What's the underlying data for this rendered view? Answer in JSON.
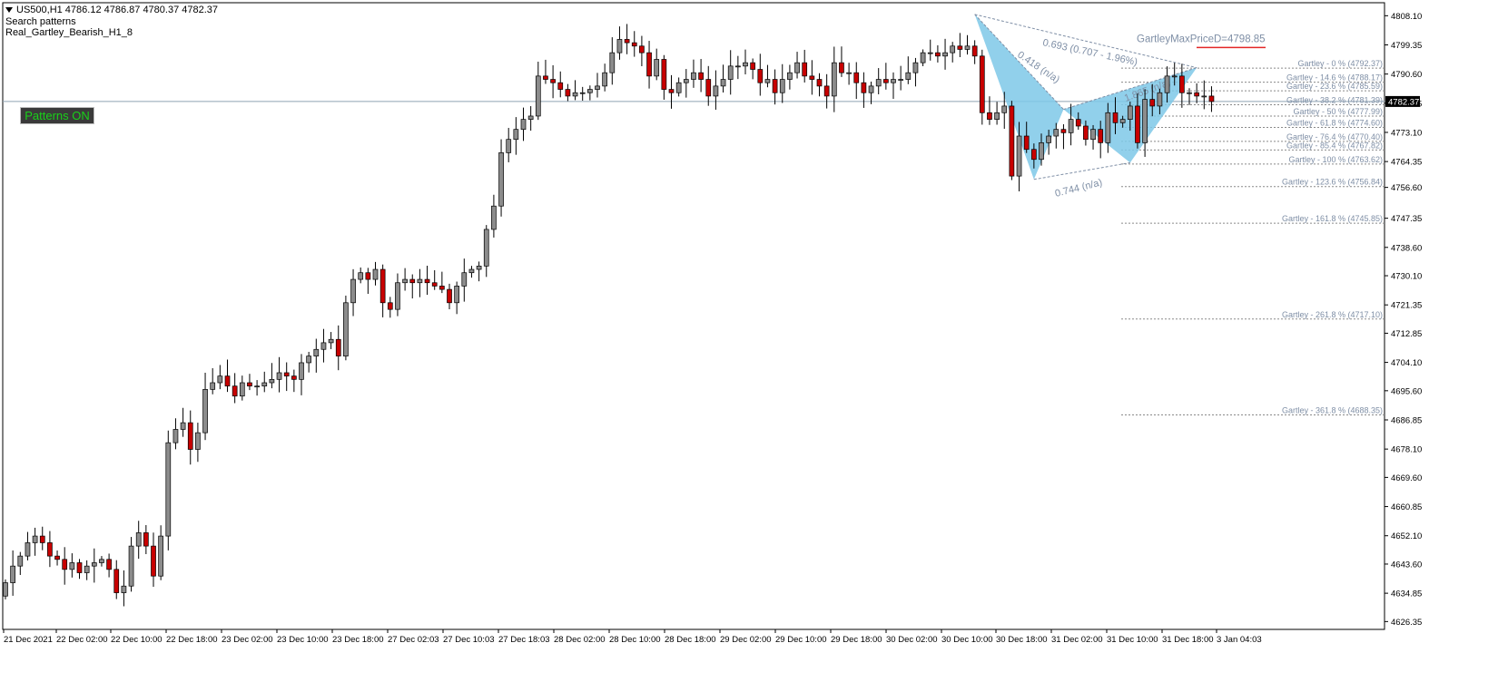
{
  "header": {
    "symbol_line": "US500,H1  4786.12 4786.87 4780.37 4782.37",
    "indicator_line": "Search patterns",
    "pattern_name": "Real_Gartley_Bearish_H1_8"
  },
  "button": {
    "label": "Patterns ON"
  },
  "colors": {
    "bull": "#8c8c8c",
    "bear": "#c80000",
    "wick": "#000000",
    "pattern_fill": "#7ec8e8",
    "fib_text": "#7f8fa6",
    "maxprice_line": "#e32626",
    "price_tag_bg": "#000000"
  },
  "chart_data": {
    "type": "candlestick",
    "symbol": "US500",
    "timeframe": "H1",
    "ylim": [
      4624,
      4812
    ],
    "yticks": [
      "4808.10",
      "4799.35",
      "4790.60",
      "4781.85",
      "4773.10",
      "4764.35",
      "4756.60",
      "4747.35",
      "4738.60",
      "4730.10",
      "4721.35",
      "4712.85",
      "4704.10",
      "4695.60",
      "4686.85",
      "4678.10",
      "4669.60",
      "4660.85",
      "4652.10",
      "4643.60",
      "4634.85",
      "4626.35"
    ],
    "xticks": [
      "21 Dec 2021",
      "22 Dec 02:00",
      "22 Dec 10:00",
      "22 Dec 18:00",
      "23 Dec 02:00",
      "23 Dec 10:00",
      "23 Dec 18:00",
      "27 Dec 02:03",
      "27 Dec 10:03",
      "27 Dec 18:03",
      "28 Dec 02:00",
      "28 Dec 10:00",
      "28 Dec 18:00",
      "29 Dec 02:00",
      "29 Dec 10:00",
      "29 Dec 18:00",
      "30 Dec 02:00",
      "30 Dec 10:00",
      "30 Dec 18:00",
      "31 Dec 02:00",
      "31 Dec 10:00",
      "31 Dec 18:00",
      "3 Jan 04:03"
    ],
    "current_price": 4782.37,
    "current_price_label": "4782.37",
    "closes": [
      4638,
      4643,
      4646,
      4650,
      4652,
      4650,
      4646,
      4645,
      4642,
      4644,
      4641,
      4643,
      4644,
      4645,
      4642,
      4635,
      4637,
      4649,
      4653,
      4649,
      4640,
      4652,
      4680,
      4684,
      4686,
      4678,
      4683,
      4696,
      4698,
      4700,
      4697,
      4694,
      4698,
      4697,
      4697,
      4698,
      4699,
      4701,
      4700,
      4699,
      4704,
      4706,
      4708,
      4710,
      4711,
      4706,
      4722,
      4729,
      4731,
      4729,
      4732,
      4722,
      4720,
      4728,
      4729,
      4728,
      4729,
      4728,
      4727,
      4726,
      4722,
      4727,
      4731,
      4732,
      4733,
      4744,
      4751,
      4767,
      4771,
      4774,
      4777,
      4778,
      4790,
      4789,
      4788,
      4786,
      4784,
      4785,
      4785,
      4786,
      4787,
      4791,
      4797,
      4801,
      4800,
      4799,
      4797,
      4790,
      4795,
      4786,
      4785,
      4788,
      4789,
      4791,
      4789,
      4784,
      4787,
      4789,
      4793,
      4793,
      4794,
      4792,
      4788,
      4789,
      4785,
      4789,
      4791,
      4794,
      4790,
      4789,
      4787,
      4784,
      4794,
      4791,
      4791,
      4788,
      4785,
      4787,
      4789,
      4788,
      4789,
      4789,
      4791,
      4794,
      4797,
      4797,
      4796,
      4797,
      4799,
      4798,
      4799,
      4796,
      4779,
      4777,
      4779,
      4781,
      4760,
      4772,
      4768,
      4765,
      4770,
      4772,
      4774,
      4773,
      4777,
      4775,
      4771,
      4774,
      4770,
      4779,
      4776,
      4777,
      4781,
      4770,
      4783,
      4781,
      4785,
      4790,
      4790,
      4785,
      4785,
      4784,
      4784,
      4782.37
    ],
    "pattern": {
      "points": [
        {
          "x": "30 Dec 09:00",
          "y": 4808.5
        },
        {
          "x": "30 Dec 19:00",
          "y": 4759.0
        },
        {
          "x": "30 Dec 23:00",
          "y": 4780.0
        },
        {
          "x": "31 Dec 09:00",
          "y": 4764.0
        },
        {
          "x": "31 Dec 19:00",
          "y": 4792.5
        }
      ],
      "ratio_labels": [
        "0.693 (0.707 - 1.96%)",
        "0.418 (n/a)",
        "1.865 (n/a)",
        "0.744 (n/a)"
      ],
      "max_price_label": "GartleyMaxPriceD=4798.85",
      "max_price": 4798.85
    },
    "fib_levels": [
      {
        "label": "Gartley - 0 % (4792.37)",
        "price": 4792.37
      },
      {
        "label": "Gartley - 14.6 % (4788.17)",
        "price": 4788.17
      },
      {
        "label": "Gartley - 23.6 % (4785.59)",
        "price": 4785.59
      },
      {
        "label": "Gartley - 38.2 % (4781.39)",
        "price": 4781.39
      },
      {
        "label": "Gartley - 50 % (4777.99)",
        "price": 4777.99
      },
      {
        "label": "Gartley - 61.8 % (4774.60)",
        "price": 4774.6
      },
      {
        "label": "Gartley - 76.4 % (4770.40)",
        "price": 4770.4
      },
      {
        "label": "Gartley - 85.4 % (4767.82)",
        "price": 4767.82
      },
      {
        "label": "Gartley - 100 % (4763.62)",
        "price": 4763.62
      },
      {
        "label": "Gartley - 123.6 % (4756.84)",
        "price": 4756.84
      },
      {
        "label": "Gartley - 161.8 % (4745.85)",
        "price": 4745.85
      },
      {
        "label": "Gartley - 261.8 % (4717.10)",
        "price": 4717.1
      },
      {
        "label": "Gartley - 361.8 % (4688.35)",
        "price": 4688.35
      }
    ]
  }
}
